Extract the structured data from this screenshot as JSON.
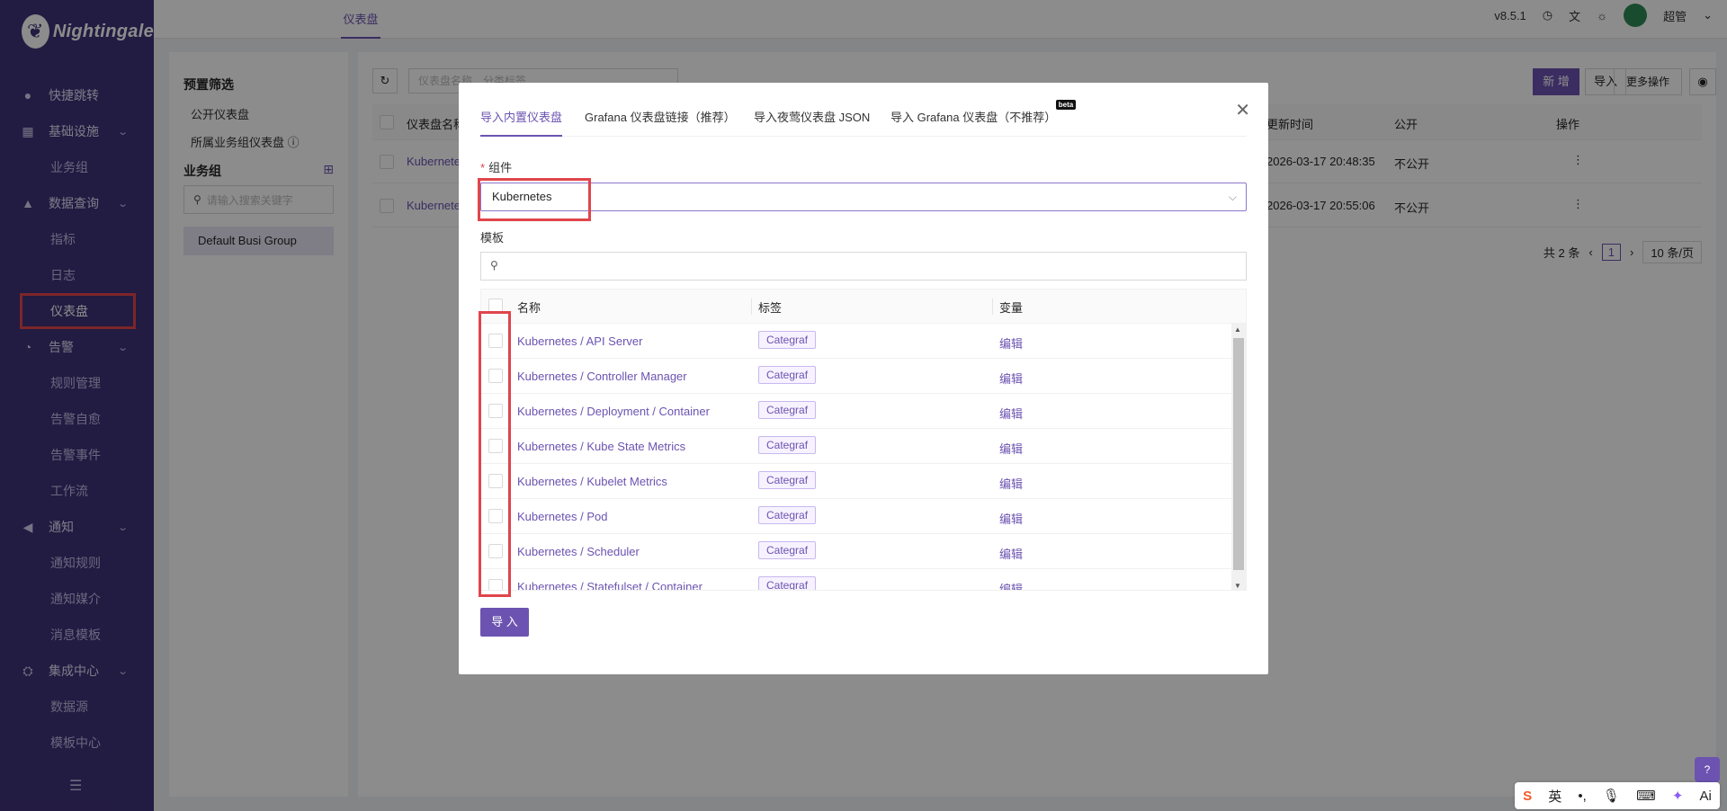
{
  "app": {
    "logo_text": "Nightingale",
    "version": "v8.5.1",
    "user": "超管"
  },
  "sidebar": {
    "quick": "快捷跳转",
    "sections": [
      {
        "label": "基础设施",
        "icon": "server-icon",
        "subs": [
          "业务组"
        ]
      },
      {
        "label": "数据查询",
        "icon": "chart-icon",
        "subs": [
          "指标",
          "日志",
          "仪表盘"
        ]
      },
      {
        "label": "告警",
        "icon": "bell-icon",
        "subs": [
          "规则管理",
          "告警自愈",
          "告警事件",
          "工作流"
        ]
      },
      {
        "label": "通知",
        "icon": "megaphone-icon",
        "subs": [
          "通知规则",
          "通知媒介",
          "消息模板"
        ]
      },
      {
        "label": "集成中心",
        "icon": "integration-icon",
        "subs": [
          "数据源",
          "模板中心"
        ]
      }
    ]
  },
  "header": {
    "tab": "仪表盘"
  },
  "left_panel": {
    "preset_title": "预置筛选",
    "preset_items": [
      "公开仪表盘",
      "所属业务组仪表盘"
    ],
    "group_title": "业务组",
    "search_placeholder": "请输入搜索关键字",
    "group_item": "Default Busi Group"
  },
  "right_panel": {
    "search_placeholder": "仪表盘名称、分类标签",
    "btn_new": "新 增",
    "btn_import": "导入",
    "btn_more": "更多操作",
    "columns": [
      "仪表盘名称",
      "更新时间",
      "公开",
      "操作"
    ],
    "rows": [
      {
        "name": "Kubernete",
        "time": "2026-03-17 20:48:35",
        "public": "不公开"
      },
      {
        "name": "Kubernete",
        "time": "2026-03-17 20:55:06",
        "public": "不公开"
      }
    ],
    "pagination": {
      "total": "共 2 条",
      "page": "1",
      "page_size": "10 条/页"
    }
  },
  "modal": {
    "tabs": [
      "导入内置仪表盘",
      "Grafana 仪表盘链接（推荐）",
      "导入夜莺仪表盘 JSON",
      "导入 Grafana 仪表盘（不推荐）"
    ],
    "beta": "beta",
    "component_label": "组件",
    "component_value": "Kubernetes",
    "template_label": "模板",
    "columns": {
      "name": "名称",
      "tags": "标签",
      "vars": "变量"
    },
    "rows": [
      {
        "name": "Kubernetes / API Server",
        "tag": "Categraf",
        "edit": "编辑"
      },
      {
        "name": "Kubernetes / Controller Manager",
        "tag": "Categraf",
        "edit": "编辑"
      },
      {
        "name": "Kubernetes / Deployment / Container",
        "tag": "Categraf",
        "edit": "编辑"
      },
      {
        "name": "Kubernetes / Kube State Metrics",
        "tag": "Categraf",
        "edit": "编辑"
      },
      {
        "name": "Kubernetes / Kubelet Metrics",
        "tag": "Categraf",
        "edit": "编辑"
      },
      {
        "name": "Kubernetes / Pod",
        "tag": "Categraf",
        "edit": "编辑"
      },
      {
        "name": "Kubernetes / Scheduler",
        "tag": "Categraf",
        "edit": "编辑"
      },
      {
        "name": "Kubernetes / Statefulset / Container",
        "tag": "Categraf",
        "edit": "编辑"
      }
    ],
    "import_button": "导 入"
  },
  "ime": {
    "lang": "英",
    "ai": "Ai"
  }
}
